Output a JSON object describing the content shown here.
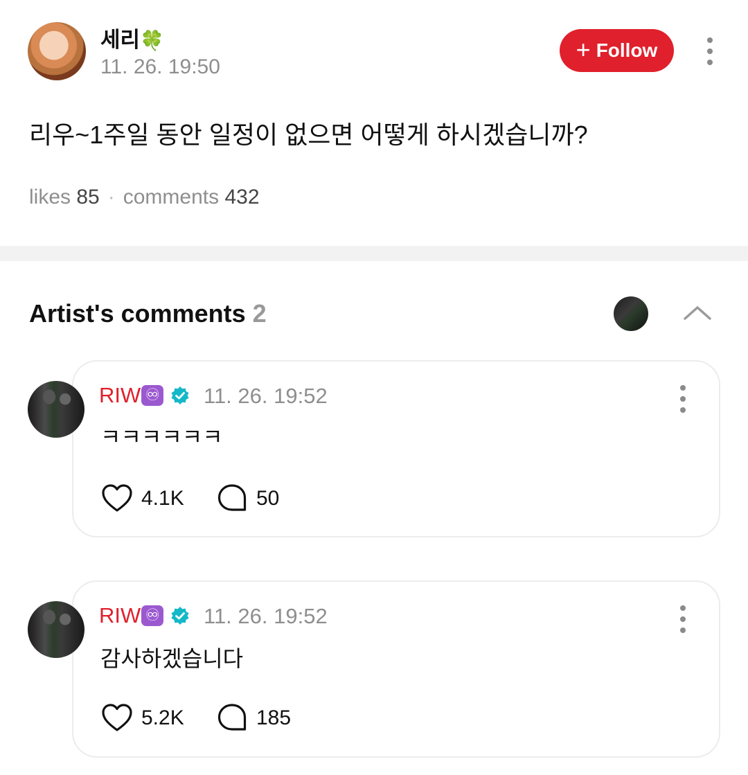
{
  "post": {
    "author": "세리",
    "author_emoji": "🍀",
    "time": "11. 26. 19:50",
    "follow_label": "Follow",
    "text": "리우~1주일 동안 일정이 없으면 어떻게 하시겠습니까?",
    "likes_label": "likes",
    "likes": "85",
    "comments_label": "comments",
    "comments": "432"
  },
  "artist_comments": {
    "title": "Artist's comments",
    "count": "2",
    "items": [
      {
        "name": "RIW",
        "badge": "♾",
        "time": "11. 26. 19:52",
        "text": "ㅋㅋㅋㅋㅋㅋ",
        "likes": "4.1K",
        "replies": "50"
      },
      {
        "name": "RIW",
        "badge": "♾",
        "time": "11. 26. 19:52",
        "text": "감사하겠습니다",
        "likes": "5.2K",
        "replies": "185"
      }
    ]
  },
  "icons": {
    "follow": "plus-icon",
    "menu": "more-vertical-icon",
    "collapse": "chevron-up-icon",
    "verified": "verified-badge-icon",
    "like": "heart-icon",
    "reply": "comment-bubble-icon"
  },
  "colors": {
    "accent": "#e0202c",
    "verified": "#14b8c8",
    "muted_text": "#8e8e8e",
    "badge_purple": "#9b59d0"
  }
}
